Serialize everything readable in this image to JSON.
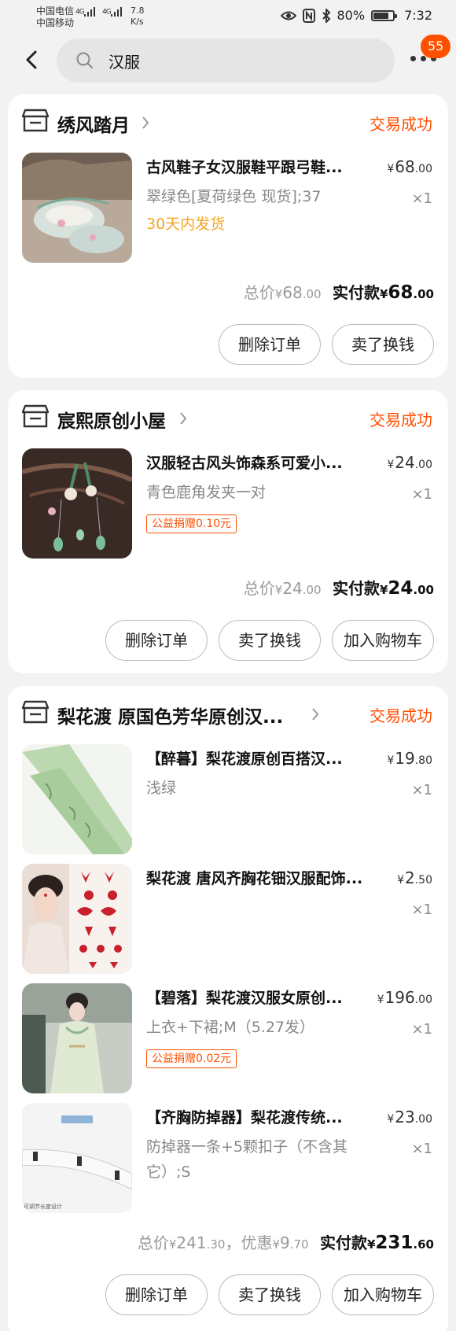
{
  "status_bar": {
    "carrier1": "中国电信",
    "carrier2": "中国移动",
    "sig1": "4G",
    "sig2": "4G",
    "net_speed_value": "7.8",
    "net_speed_unit": "K/s",
    "battery_percent": "80%",
    "battery_level": 0.8,
    "time": "7:32"
  },
  "header": {
    "search_query": "汉服",
    "badge_count": "55"
  },
  "orders": [
    {
      "shop": "绣风踏月",
      "status": "交易成功",
      "items": [
        {
          "title": "古风鞋子女汉服鞋平跟弓鞋...",
          "sku": "翠绿色[夏荷绿色 现货];37",
          "note": "30天内发货",
          "price_int": "68",
          "price_dec": ".00",
          "qty": "×1"
        }
      ],
      "total_label": "总价",
      "total_int": "68",
      "total_dec": ".00",
      "pay_label": "实付款",
      "pay_int": "68",
      "pay_dec": ".00",
      "buttons": [
        "删除订单",
        "卖了换钱"
      ]
    },
    {
      "shop": "宸熙原创小屋",
      "status": "交易成功",
      "items": [
        {
          "title": "汉服轻古风头饰森系可爱小...",
          "sku": "青色鹿角发夹一对",
          "charity": "公益捐赠0.10元",
          "price_int": "24",
          "price_dec": ".00",
          "qty": "×1"
        }
      ],
      "total_label": "总价",
      "total_int": "24",
      "total_dec": ".00",
      "pay_label": "实付款",
      "pay_int": "24",
      "pay_dec": ".00",
      "buttons": [
        "删除订单",
        "卖了换钱",
        "加入购物车"
      ]
    },
    {
      "shop": "梨花渡 原国色芳华原创汉...",
      "status": "交易成功",
      "items": [
        {
          "title": "【醉暮】梨花渡原创百搭汉...",
          "sku": "浅绿",
          "price_int": "19",
          "price_dec": ".80",
          "qty": "×1"
        },
        {
          "title": "梨花渡 唐风齐胸花钿汉服配饰...",
          "sku": "",
          "price_int": "2",
          "price_dec": ".50",
          "qty": "×1"
        },
        {
          "title": "【碧落】梨花渡汉服女原创...",
          "sku": "上衣+下裙;M（5.27发）",
          "charity": "公益捐赠0.02元",
          "price_int": "196",
          "price_dec": ".00",
          "qty": "×1"
        },
        {
          "title": "【齐胸防掉器】梨花渡传统...",
          "sku": "防掉器一条+5颗扣子（不含其它）;S",
          "thumb_text": "可调节长度设计",
          "price_int": "23",
          "price_dec": ".00",
          "qty": "×1"
        }
      ],
      "total_label": "总价",
      "total_int": "241",
      "total_dec": ".30",
      "discount_label": "，优惠",
      "discount_int": "9",
      "discount_dec": ".70",
      "pay_label": "实付款",
      "pay_int": "231",
      "pay_dec": ".60",
      "buttons": [
        "删除订单",
        "卖了换钱",
        "加入购物车"
      ]
    }
  ],
  "currency": "¥",
  "colors": {
    "accent": "#ff5000",
    "note": "#f5a623",
    "background": "#f2f2f2"
  }
}
